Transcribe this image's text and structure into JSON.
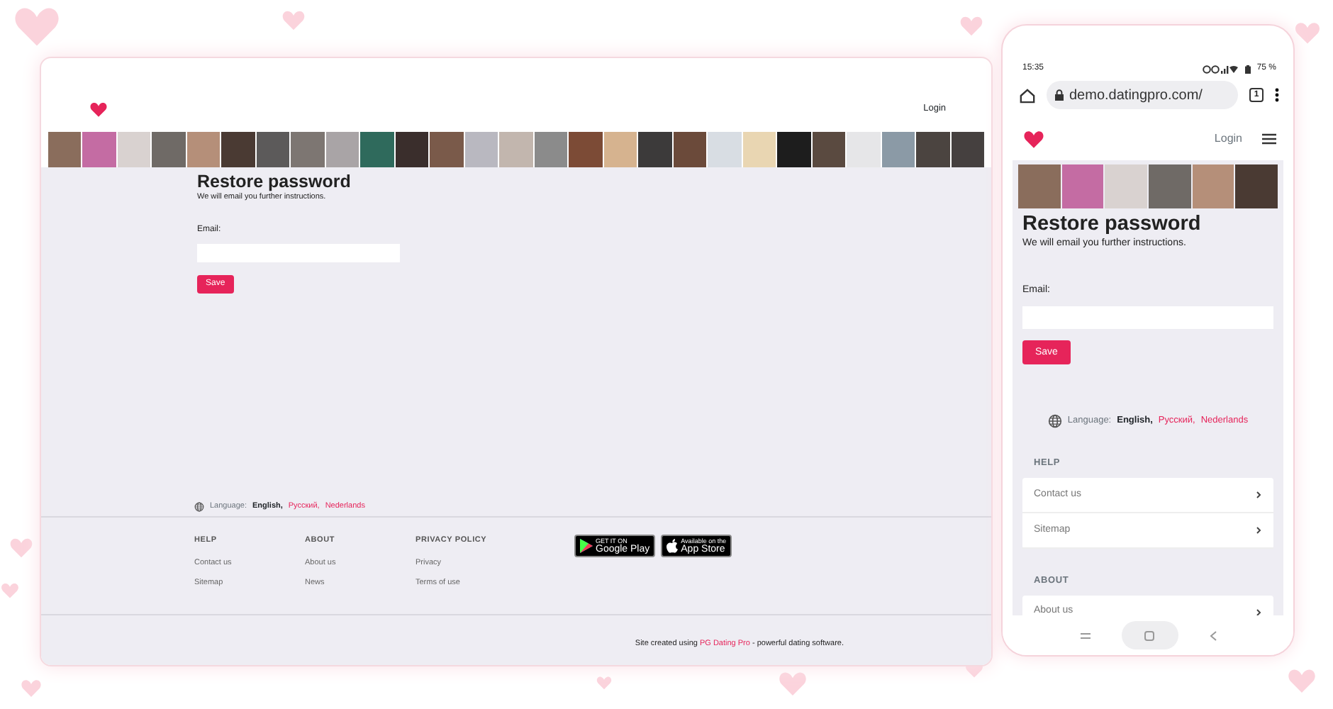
{
  "desktop": {
    "nav": {
      "login": "Login"
    },
    "form": {
      "title": "Restore password",
      "subtitle": "We will email you further instructions.",
      "email_label": "Email:",
      "save": "Save"
    },
    "language": {
      "label": "Language:",
      "options": [
        {
          "name": "English,",
          "selected": true
        },
        {
          "name": "Русский,",
          "selected": false
        },
        {
          "name": "Nederlands",
          "selected": false
        }
      ]
    },
    "footer": {
      "columns": [
        {
          "heading": "HELP",
          "links": [
            "Contact us",
            "Sitemap"
          ]
        },
        {
          "heading": "ABOUT",
          "links": [
            "About us",
            "News"
          ]
        },
        {
          "heading": "PRIVACY POLICY",
          "links": [
            "Privacy",
            "Terms of use"
          ]
        }
      ],
      "store_badges": [
        {
          "kind": "google",
          "small": "GET IT ON",
          "large": "Google Play"
        },
        {
          "kind": "apple",
          "small": "Available on the",
          "large": "App Store"
        }
      ],
      "credit": {
        "before": "Site created using",
        "link": "PG Dating Pro",
        "after": "- powerful dating software."
      }
    }
  },
  "phone": {
    "status_bar": {
      "time": "15:35",
      "battery": "75 %"
    },
    "browser": {
      "url": "demo.datingpro.com/",
      "tab_count": "1"
    },
    "nav": {
      "login": "Login"
    },
    "form": {
      "title": "Restore password",
      "subtitle": "We will email you further instructions.",
      "email_label": "Email:",
      "save": "Save"
    },
    "language": {
      "label": "Language:",
      "options": [
        {
          "name": "English,",
          "selected": true
        },
        {
          "name": "Русский,",
          "selected": false
        },
        {
          "name": "Nederlands",
          "selected": false
        }
      ]
    },
    "footer_sections": [
      {
        "heading": "HELP",
        "links": [
          "Contact us",
          "Sitemap"
        ]
      },
      {
        "heading": "ABOUT",
        "links": [
          "About us"
        ]
      }
    ]
  }
}
